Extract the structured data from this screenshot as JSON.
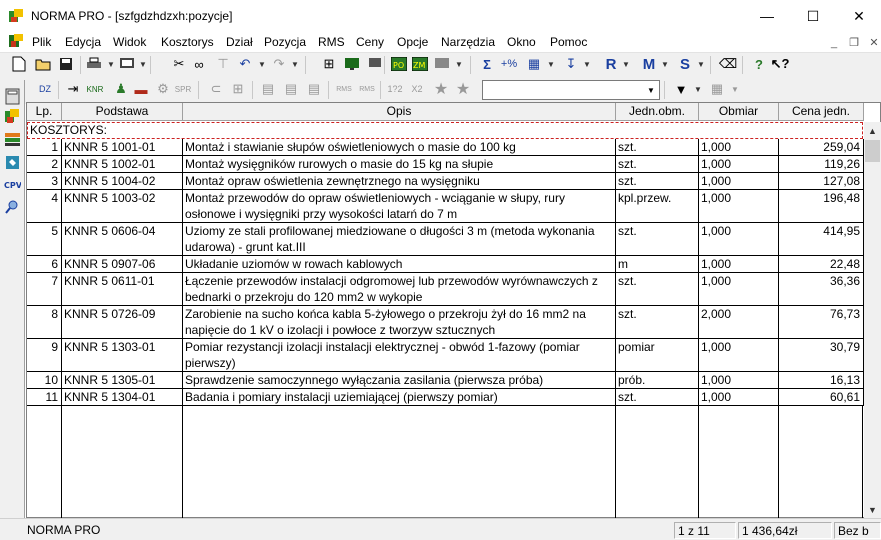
{
  "window": {
    "title": "NORMA PRO - [szfgdzhdzxh:pozycje]",
    "minimize": "—",
    "maximize": "☐",
    "close": "✕"
  },
  "menu": {
    "items": [
      "Plik",
      "Edycja",
      "Widok",
      "Kosztorys",
      "Dział",
      "Pozycja",
      "RMS",
      "Ceny",
      "Opcje",
      "Narzędzia",
      "Okno",
      "Pomoc"
    ]
  },
  "toolbar": {
    "sigma": "Σ",
    "percent": "+%",
    "r_label": "R",
    "m_label": "M",
    "s_label": "S",
    "help": "?",
    "kr_label": "KNR",
    "spr_label": "SPR",
    "rms_label": "RMS",
    "rms2_label": "RMS",
    "dz_label": "DZ",
    "frac_label": "1?2",
    "x2_label": "X2",
    "filter_value": ""
  },
  "table": {
    "headers": {
      "lp": "Lp.",
      "podstawa": "Podstawa",
      "opis": "Opis",
      "jedn": "Jedn.obm.",
      "obmiar": "Obmiar",
      "cena": "Cena jedn."
    },
    "section_label": "KOSZTORYS:",
    "rows": [
      {
        "lp": "1",
        "podstawa": "KNNR 5 1001-01",
        "opis": "Montaż i stawianie słupów oświetleniowych o masie do 100 kg",
        "jedn": "szt.",
        "obmiar": "1,000",
        "cena": "259,04"
      },
      {
        "lp": "2",
        "podstawa": "KNNR 5 1002-01",
        "opis": "Montaż wysięgników rurowych o masie do 15 kg na słupie",
        "jedn": "szt.",
        "obmiar": "1,000",
        "cena": "119,26"
      },
      {
        "lp": "3",
        "podstawa": "KNNR 5 1004-02",
        "opis": "Montaż opraw oświetlenia zewnętrznego na wysięgniku",
        "jedn": "szt.",
        "obmiar": "1,000",
        "cena": "127,08"
      },
      {
        "lp": "4",
        "podstawa": "KNNR 5 1003-02",
        "opis": "Montaż przewodów do opraw oświetleniowych - wciąganie w słupy, rury osłonowe i wysięgniki przy wysokości latarń do 7 m",
        "jedn": "kpl.przew.",
        "obmiar": "1,000",
        "cena": "196,48"
      },
      {
        "lp": "5",
        "podstawa": "KNNR 5 0606-04",
        "opis": "Uziomy ze stali profilowanej miedziowane o długości 3 m (metoda wykonania udarowa) - grunt kat.III",
        "jedn": "szt.",
        "obmiar": "1,000",
        "cena": "414,95"
      },
      {
        "lp": "6",
        "podstawa": "KNNR 5 0907-06",
        "opis": "Układanie uziomów w rowach kablowych",
        "jedn": "m",
        "obmiar": "1,000",
        "cena": "22,48"
      },
      {
        "lp": "7",
        "podstawa": "KNNR 5 0611-01",
        "opis": "Łączenie przewodów instalacji odgromowej lub przewodów wyrównawczych z bednarki o przekroju do 120 mm2 w wykopie",
        "jedn": "szt.",
        "obmiar": "1,000",
        "cena": "36,36"
      },
      {
        "lp": "8",
        "podstawa": "KNNR 5 0726-09",
        "opis": "Zarobienie na sucho końca kabla 5-żyłowego o przekroju żył do 16 mm2 na napięcie do 1 kV o izolacji i powłoce z tworzyw sztucznych",
        "jedn": "szt.",
        "obmiar": "2,000",
        "cena": "76,73"
      },
      {
        "lp": "9",
        "podstawa": "KNNR 5 1303-01",
        "opis": "Pomiar rezystancji izolacji instalacji elektrycznej - obwód 1-fazowy (pomiar pierwszy)",
        "jedn": "pomiar",
        "obmiar": "1,000",
        "cena": "30,79"
      },
      {
        "lp": "10",
        "podstawa": "KNNR 5 1305-01",
        "opis": "Sprawdzenie samoczynnego wyłączania zasilania (pierwsza próba)",
        "jedn": "prób.",
        "obmiar": "1,000",
        "cena": "16,13"
      },
      {
        "lp": "11",
        "podstawa": "KNNR 5 1304-01",
        "opis": "Badania i pomiary instalacji uziemiającej (pierwszy pomiar)",
        "jedn": "szt.",
        "obmiar": "1,000",
        "cena": "60,61"
      }
    ]
  },
  "status": {
    "app": "NORMA PRO",
    "position": "1 z 11",
    "total": "1 436,64zł",
    "mode": "Bez b"
  },
  "colors": {
    "section_border": "#cc2222",
    "toolbar_bg": "#f0f0f0"
  }
}
